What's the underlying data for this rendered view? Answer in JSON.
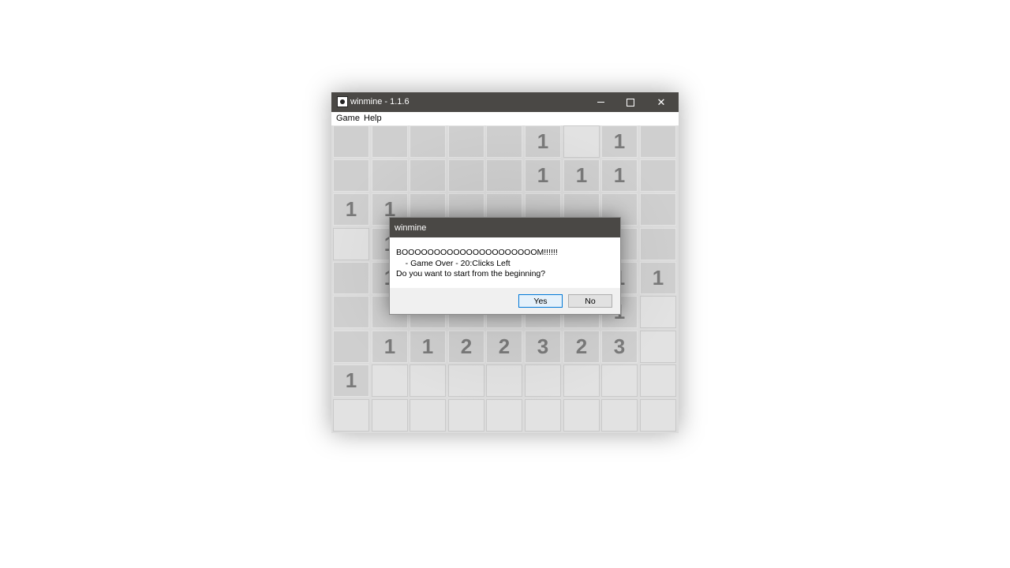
{
  "window": {
    "title": "winmine - 1.1.6",
    "minimize_icon": "minimize-icon",
    "maximize_icon": "maximize-icon",
    "close_glyph": "✕"
  },
  "menu": {
    "game": "Game",
    "help": "Help"
  },
  "board": {
    "rows": [
      [
        "",
        "",
        "",
        "",
        "",
        "1",
        "",
        "1",
        ""
      ],
      [
        "",
        "",
        "",
        "",
        "",
        "1",
        "1",
        "1",
        ""
      ],
      [
        "1",
        "1",
        "",
        "",
        "",
        "",
        "",
        "",
        ""
      ],
      [
        "",
        "1",
        "",
        "",
        "",
        "",
        "",
        "",
        ""
      ],
      [
        "",
        "1",
        "",
        "",
        "",
        "",
        "",
        "1",
        "1"
      ],
      [
        "",
        "",
        "",
        "",
        "",
        "",
        "",
        "1",
        ""
      ],
      [
        "",
        "1",
        "1",
        "2",
        "2",
        "3",
        "2",
        "3",
        ""
      ],
      [
        "1",
        "",
        "",
        "",
        "",
        "",
        "",
        "",
        ""
      ],
      [
        "",
        "",
        "",
        "",
        "",
        "",
        "",
        "",
        ""
      ]
    ],
    "revealed": [
      [
        0,
        0,
        0,
        0,
        0,
        0,
        1,
        0,
        0
      ],
      [
        0,
        0,
        0,
        0,
        0,
        0,
        0,
        0,
        0
      ],
      [
        0,
        0,
        0,
        0,
        0,
        0,
        0,
        0,
        0
      ],
      [
        1,
        0,
        0,
        0,
        0,
        0,
        0,
        0,
        0
      ],
      [
        0,
        0,
        0,
        0,
        0,
        0,
        0,
        0,
        0
      ],
      [
        0,
        0,
        0,
        0,
        0,
        0,
        0,
        0,
        1
      ],
      [
        0,
        0,
        0,
        0,
        0,
        0,
        0,
        0,
        1
      ],
      [
        0,
        1,
        1,
        1,
        1,
        1,
        1,
        1,
        1
      ],
      [
        1,
        1,
        1,
        1,
        1,
        1,
        1,
        1,
        1
      ]
    ]
  },
  "dialog": {
    "title": "winmine",
    "message": "BOOOOOOOOOOOOOOOOOOOOOM!!!!!!\n    - Game Over - 20:Clicks Left\nDo you want to start from the beginning?",
    "yes_label": "Yes",
    "no_label": "No"
  },
  "colors": {
    "titlebar": "#4a4845",
    "cell_covered": "#cfcfcf",
    "cell_revealed": "#e2e2e2",
    "number": "#7a7a7a",
    "default_button_border": "#0078d7"
  }
}
